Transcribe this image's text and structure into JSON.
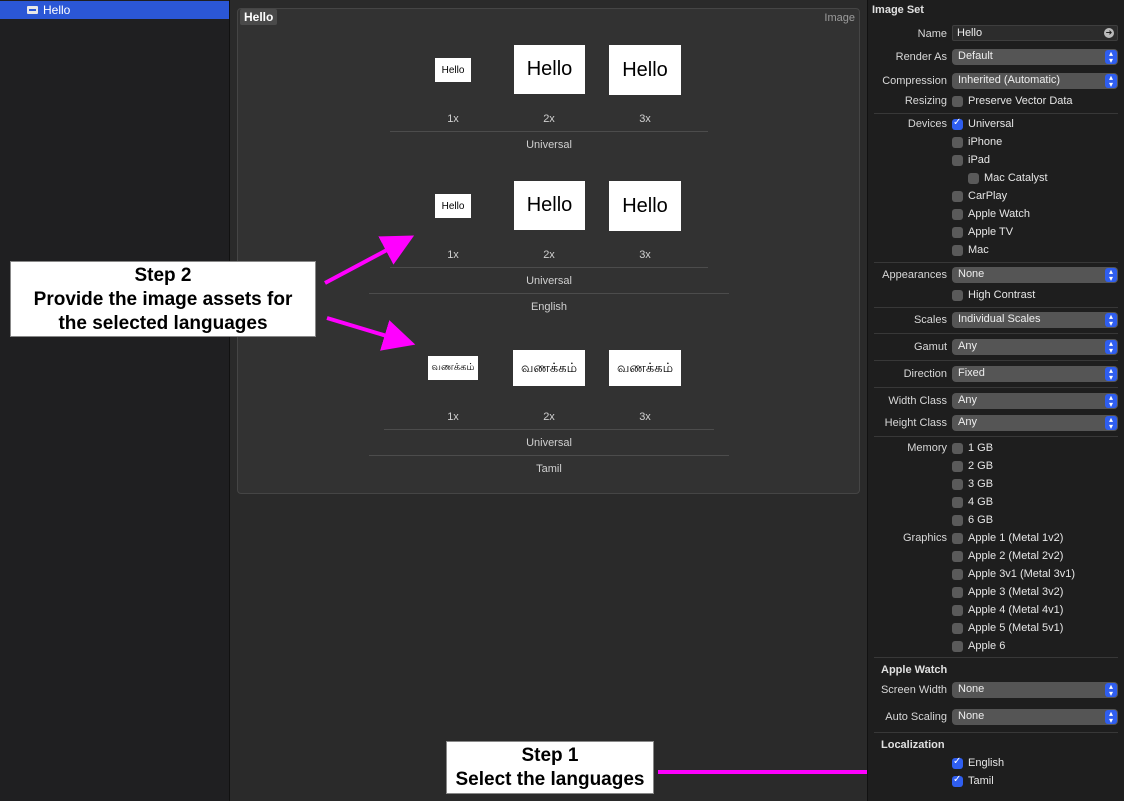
{
  "outline": {
    "item": "Hello"
  },
  "editor": {
    "set_name": "Hello",
    "set_kind": "Image",
    "groups": [
      {
        "tile_text": "Hello",
        "scales": [
          "1x",
          "2x",
          "3x"
        ],
        "device": "Universal",
        "language": ""
      },
      {
        "tile_text": "Hello",
        "scales": [
          "1x",
          "2x",
          "3x"
        ],
        "device": "Universal",
        "language": "English"
      },
      {
        "tile_text": "வணக்கம்",
        "scales": [
          "1x",
          "2x",
          "3x"
        ],
        "device": "Universal",
        "language": "Tamil"
      }
    ]
  },
  "annotations": {
    "step2": [
      "Step 2",
      "Provide the image assets for",
      "the selected languages"
    ],
    "step1": [
      "Step 1",
      "Select the languages"
    ],
    "arrow_color": "#ff00ff"
  },
  "inspector": {
    "header": "Image Set",
    "name_label": "Name",
    "name_value": "Hello",
    "render_as_label": "Render As",
    "render_as_value": "Default",
    "compression_label": "Compression",
    "compression_value": "Inherited (Automatic)",
    "resizing_label": "Resizing",
    "resizing_option": "Preserve Vector Data",
    "devices_label": "Devices",
    "devices": [
      {
        "label": "Universal",
        "checked": true
      },
      {
        "label": "iPhone",
        "checked": false
      },
      {
        "label": "iPad",
        "checked": false
      },
      {
        "label": "Mac Catalyst",
        "checked": false
      },
      {
        "label": "CarPlay",
        "checked": false
      },
      {
        "label": "Apple Watch",
        "checked": false
      },
      {
        "label": "Apple TV",
        "checked": false
      },
      {
        "label": "Mac",
        "checked": false
      }
    ],
    "appearances_label": "Appearances",
    "appearances_value": "None",
    "high_contrast": "High Contrast",
    "scales_label": "Scales",
    "scales_value": "Individual Scales",
    "gamut_label": "Gamut",
    "gamut_value": "Any",
    "direction_label": "Direction",
    "direction_value": "Fixed",
    "width_class_label": "Width Class",
    "width_class_value": "Any",
    "height_class_label": "Height Class",
    "height_class_value": "Any",
    "memory_label": "Memory",
    "memory": [
      "1 GB",
      "2 GB",
      "3 GB",
      "4 GB",
      "6 GB"
    ],
    "graphics_label": "Graphics",
    "graphics": [
      "Apple 1 (Metal 1v2)",
      "Apple 2 (Metal 2v2)",
      "Apple 3v1 (Metal 3v1)",
      "Apple 3 (Metal 3v2)",
      "Apple 4 (Metal 4v1)",
      "Apple 5 (Metal 5v1)",
      "Apple 6"
    ],
    "apple_watch_header": "Apple Watch",
    "screen_width_label": "Screen Width",
    "screen_width_value": "None",
    "auto_scaling_label": "Auto Scaling",
    "auto_scaling_value": "None",
    "localization_header": "Localization",
    "localization": [
      {
        "label": "English",
        "checked": true
      },
      {
        "label": "Tamil",
        "checked": true
      }
    ],
    "accent": "#2f5ef0"
  }
}
